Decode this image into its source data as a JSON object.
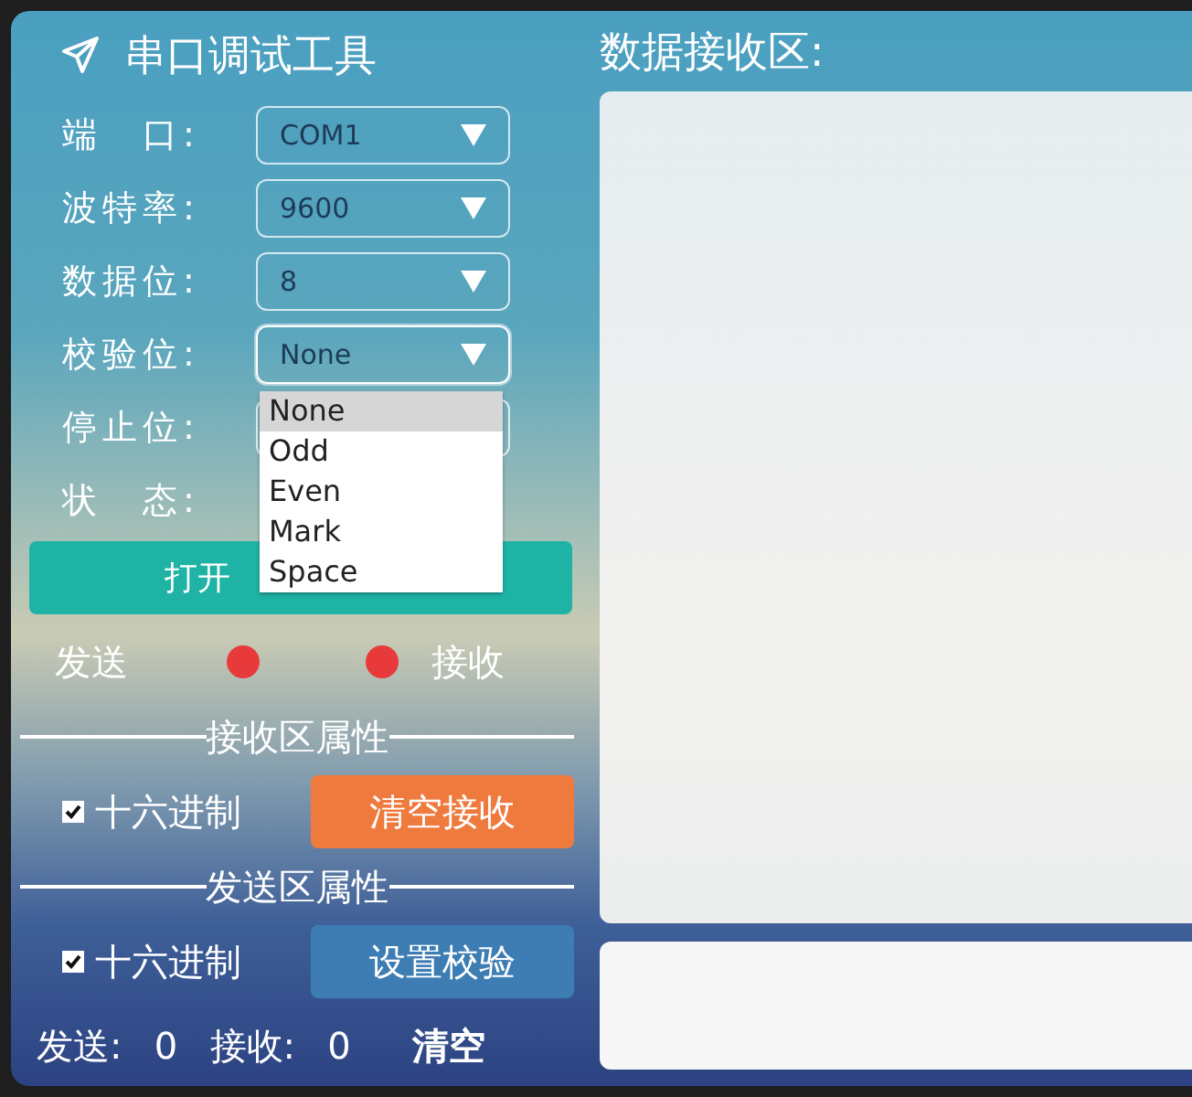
{
  "app_title": "串口调试工具",
  "settings": [
    {
      "label": "端　口:",
      "value": "COM1"
    },
    {
      "label": "波特率:",
      "value": "9600"
    },
    {
      "label": "数据位:",
      "value": "8"
    },
    {
      "label": "校验位:",
      "value": "None",
      "expanded": true,
      "options": [
        {
          "label": "None",
          "selected": true
        },
        {
          "label": "Odd",
          "selected": false
        },
        {
          "label": "Even",
          "selected": false
        },
        {
          "label": "Mark",
          "selected": false
        },
        {
          "label": "Space",
          "selected": false
        }
      ]
    },
    {
      "label": "停止位:"
    }
  ],
  "status_label": "状　态:",
  "open_button": "打开",
  "indicators": {
    "send_label": "发送",
    "receive_label": "接收"
  },
  "receive_section": {
    "heading": "接收区属性",
    "hex_label": "十六进制",
    "hex_checked": true,
    "button": "清空接收"
  },
  "send_section": {
    "heading": "发送区属性",
    "hex_label": "十六进制",
    "hex_checked": true,
    "button": "设置校验"
  },
  "counters": {
    "send_label": "发送:",
    "send_value": "0",
    "receive_label": "接收:",
    "receive_value": "0",
    "clear": "清空"
  },
  "receive_area": {
    "title": "数据接收区:"
  }
}
